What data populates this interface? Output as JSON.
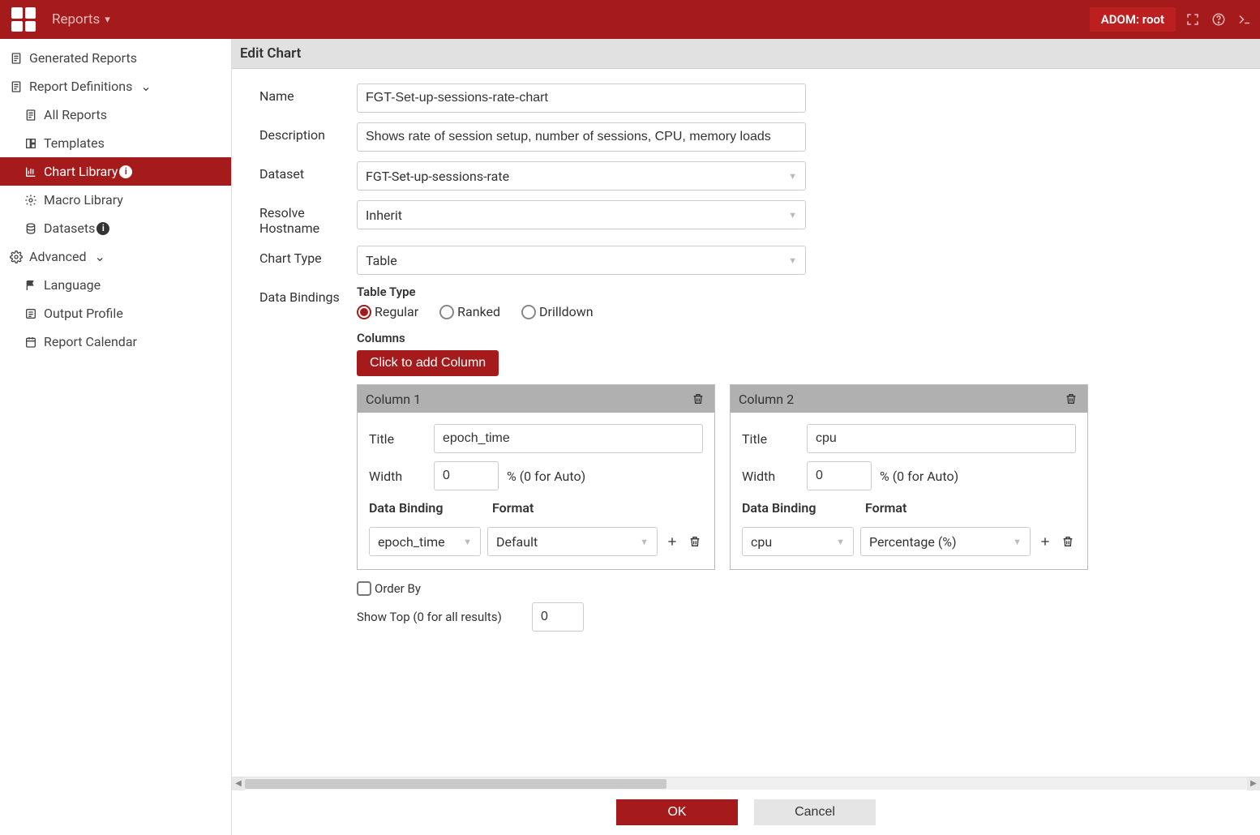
{
  "header": {
    "breadcrumb": "Reports",
    "adom": "ADOM: root"
  },
  "sidebar": {
    "generated_reports": "Generated Reports",
    "report_definitions": "Report Definitions",
    "all_reports": "All Reports",
    "templates": "Templates",
    "chart_library": "Chart Library",
    "macro_library": "Macro Library",
    "datasets": "Datasets",
    "advanced": "Advanced",
    "language": "Language",
    "output_profile": "Output Profile",
    "report_calendar": "Report Calendar"
  },
  "panel": {
    "title": "Edit Chart",
    "fields": {
      "name_label": "Name",
      "name_value": "FGT-Set-up-sessions-rate-chart",
      "description_label": "Description",
      "description_value": "Shows rate of session setup, number of sessions, CPU, memory loads",
      "dataset_label": "Dataset",
      "dataset_value": "FGT-Set-up-sessions-rate",
      "resolve_label": "Resolve Hostname",
      "resolve_value": "Inherit",
      "chart_type_label": "Chart Type",
      "chart_type_value": "Table",
      "data_bindings_label": "Data Bindings",
      "table_type_label": "Table Type",
      "table_type_options": {
        "regular": "Regular",
        "ranked": "Ranked",
        "drilldown": "Drilldown"
      },
      "columns_label": "Columns",
      "add_column_btn": "Click to add Column",
      "order_by": "Order By",
      "show_top_label": "Show Top (0 for all results)",
      "show_top_value": "0"
    },
    "columns": [
      {
        "head": "Column 1",
        "title_label": "Title",
        "title_value": "epoch_time",
        "width_label": "Width",
        "width_value": "0",
        "width_hint": "% (0 for Auto)",
        "db_label": "Data Binding",
        "fmt_label": "Format",
        "db_value": "epoch_time",
        "fmt_value": "Default"
      },
      {
        "head": "Column 2",
        "title_label": "Title",
        "title_value": "cpu",
        "width_label": "Width",
        "width_value": "0",
        "width_hint": "% (0 for Auto)",
        "db_label": "Data Binding",
        "fmt_label": "Format",
        "db_value": "cpu",
        "fmt_value": "Percentage (%)"
      }
    ],
    "footer": {
      "ok": "OK",
      "cancel": "Cancel"
    }
  }
}
